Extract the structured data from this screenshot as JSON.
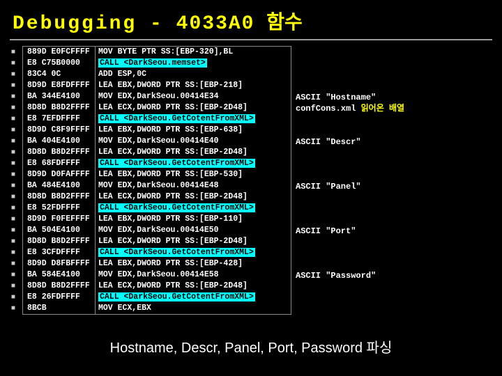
{
  "title": {
    "en": "Debugging",
    "sep": " - ",
    "addr": "4033A0",
    "kr": " 함수"
  },
  "rows": [
    {
      "hex": "889D E0FCFFFF",
      "asm": "MOV BYTE PTR SS:[EBP-320],BL",
      "call": false
    },
    {
      "hex": "E8 C75B0000",
      "asm": "CALL <DarkSeou.memset>",
      "call": true
    },
    {
      "hex": "83C4 0C",
      "asm": "ADD ESP,0C",
      "call": false
    },
    {
      "hex": "8D9D E8FDFFFF",
      "asm": "LEA EBX,DWORD PTR SS:[EBP-218]",
      "call": false
    },
    {
      "hex": "BA 344E4100",
      "asm": "MOV EDX,DarkSeou.00414E34",
      "call": false
    },
    {
      "hex": "8D8D B8D2FFFF",
      "asm": "LEA ECX,DWORD PTR SS:[EBP-2D48]",
      "call": false
    },
    {
      "hex": "E8 7EFDFFFF",
      "asm": "CALL <DarkSeou.GetCotentFromXML>",
      "call": true
    },
    {
      "hex": "8D9D C8F9FFFF",
      "asm": "LEA EBX,DWORD PTR SS:[EBP-638]",
      "call": false
    },
    {
      "hex": "BA 404E4100",
      "asm": "MOV EDX,DarkSeou.00414E40",
      "call": false
    },
    {
      "hex": "8D8D B8D2FFFF",
      "asm": "LEA ECX,DWORD PTR SS:[EBP-2D48]",
      "call": false
    },
    {
      "hex": "E8 68FDFFFF",
      "asm": "CALL <DarkSeou.GetCotentFromXML>",
      "call": true
    },
    {
      "hex": "8D9D D0FAFFFF",
      "asm": "LEA EBX,DWORD PTR SS:[EBP-530]",
      "call": false
    },
    {
      "hex": "BA 484E4100",
      "asm": "MOV EDX,DarkSeou.00414E48",
      "call": false
    },
    {
      "hex": "8D8D B8D2FFFF",
      "asm": "LEA ECX,DWORD PTR SS:[EBP-2D48]",
      "call": false
    },
    {
      "hex": "E8 52FDFFFF",
      "asm": "CALL <DarkSeou.GetCotentFromXML>",
      "call": true
    },
    {
      "hex": "8D9D F0FEFFFF",
      "asm": "LEA EBX,DWORD PTR SS:[EBP-110]",
      "call": false
    },
    {
      "hex": "BA 504E4100",
      "asm": "MOV EDX,DarkSeou.00414E50",
      "call": false
    },
    {
      "hex": "8D8D B8D2FFFF",
      "asm": "LEA ECX,DWORD PTR SS:[EBP-2D48]",
      "call": false
    },
    {
      "hex": "E8 3CFDFFFF",
      "asm": "CALL <DarkSeou.GetCotentFromXML>",
      "call": true
    },
    {
      "hex": "8D9D D8FBFFFF",
      "asm": "LEA EBX,DWORD PTR SS:[EBP-428]",
      "call": false
    },
    {
      "hex": "BA 584E4100",
      "asm": "MOV EDX,DarkSeou.00414E58",
      "call": false
    },
    {
      "hex": "8D8D B8D2FFFF",
      "asm": "LEA ECX,DWORD PTR SS:[EBP-2D48]",
      "call": false
    },
    {
      "hex": "E8 26FDFFFF",
      "asm": "CALL <DarkSeou.GetCotentFromXML>",
      "call": true
    },
    {
      "hex": "8BCB",
      "asm": "MOV ECX,EBX",
      "call": false
    }
  ],
  "annotations": [
    {
      "row": 4,
      "white": "ASCII \"Hostname\"",
      "yellow": ""
    },
    {
      "row": 5,
      "white": "confCons.xml ",
      "yellow": "읽어온 배열"
    },
    {
      "row": 8,
      "white": "ASCII \"Descr\"",
      "yellow": ""
    },
    {
      "row": 12,
      "white": "ASCII \"Panel\"",
      "yellow": ""
    },
    {
      "row": 16,
      "white": "ASCII \"Port\"",
      "yellow": ""
    },
    {
      "row": 20,
      "white": "ASCII \"Password\"",
      "yellow": ""
    }
  ],
  "caption": "Hostname, Descr, Panel, Port, Password 파싱"
}
